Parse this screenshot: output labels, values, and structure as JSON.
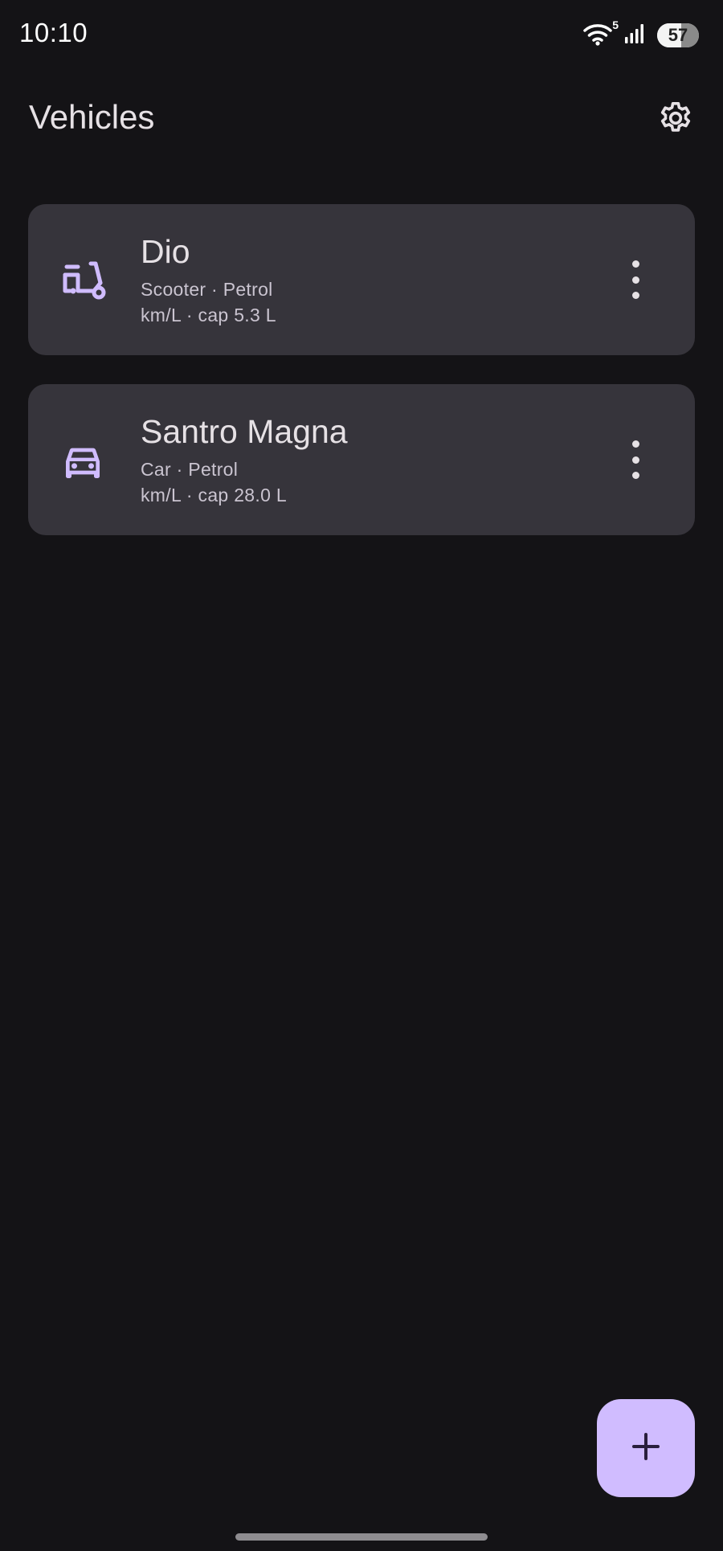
{
  "status_bar": {
    "time": "10:10",
    "wifi_generation": "5",
    "battery_level": "57",
    "battery_fraction": 0.57
  },
  "app_bar": {
    "title": "Vehicles",
    "settings_icon": "gear-icon"
  },
  "vehicles": [
    {
      "name": "Dio",
      "type_line": "Scooter · Petrol",
      "spec_line": "km/L · cap 5.3 L",
      "icon": "scooter-icon"
    },
    {
      "name": "Santro Magna",
      "type_line": "Car · Petrol",
      "spec_line": "km/L · cap 28.0 L",
      "icon": "car-icon"
    }
  ],
  "fab": {
    "icon": "plus-icon"
  },
  "colors": {
    "background": "#141316",
    "card": "#36343b",
    "accent": "#d0bcff",
    "text_primary": "#e6e1e5",
    "text_secondary": "#cac4d0"
  }
}
